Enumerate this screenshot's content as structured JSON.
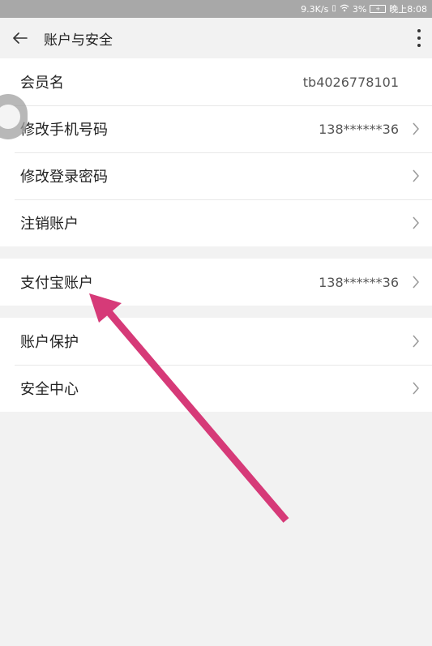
{
  "status_bar": {
    "speed": "9.3K/s",
    "battery_pct": "3%",
    "time": "晚上8:08"
  },
  "header": {
    "title": "账户与安全"
  },
  "groups": [
    {
      "items": [
        {
          "label": "会员名",
          "value": "tb4026778101",
          "chevron": false
        },
        {
          "label": "修改手机号码",
          "value": "138******36",
          "chevron": true
        },
        {
          "label": "修改登录密码",
          "value": "",
          "chevron": true
        },
        {
          "label": "注销账户",
          "value": "",
          "chevron": true
        }
      ]
    },
    {
      "items": [
        {
          "label": "支付宝账户",
          "value": "138******36",
          "chevron": true
        }
      ]
    },
    {
      "items": [
        {
          "label": "账户保护",
          "value": "",
          "chevron": true
        },
        {
          "label": "安全中心",
          "value": "",
          "chevron": true
        }
      ]
    }
  ],
  "colors": {
    "annotation_arrow": "#d63a78",
    "background": "#f2f2f2",
    "status_bar": "#a8a8a8"
  },
  "icons": [
    "back-arrow-icon",
    "more-vertical-icon",
    "chevron-right-icon",
    "vibrate-icon",
    "wifi-icon",
    "battery-icon",
    "floating-assist-ball"
  ]
}
